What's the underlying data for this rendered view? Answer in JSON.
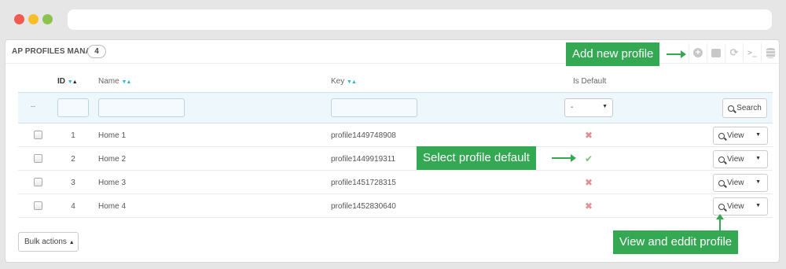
{
  "panel": {
    "title": "AP PROFILES MANAGE",
    "count": "4"
  },
  "toolbar": {
    "icons": [
      "add-icon",
      "export-icon",
      "refresh-icon",
      "sql-icon",
      "database-icon"
    ],
    "sql_glyph": ">_"
  },
  "table": {
    "columns": {
      "id": "ID",
      "name": "Name",
      "key": "Key",
      "is_default": "Is Default"
    },
    "filters": {
      "dash": "--",
      "default_select_value": "-",
      "search_label": "Search"
    },
    "rows": [
      {
        "id": "1",
        "name": "Home 1",
        "key": "profile1449748908",
        "is_default": false,
        "action": "View"
      },
      {
        "id": "2",
        "name": "Home 2",
        "key": "profile1449919311",
        "is_default": true,
        "action": "View"
      },
      {
        "id": "3",
        "name": "Home 3",
        "key": "profile1451728315",
        "is_default": false,
        "action": "View"
      },
      {
        "id": "4",
        "name": "Home 4",
        "key": "profile1452830640",
        "is_default": false,
        "action": "View"
      }
    ],
    "bulk_actions_label": "Bulk actions"
  },
  "callouts": {
    "add_new": "Add new profile",
    "select_default": "Select profile default",
    "view_edit": "View and eddit profile"
  },
  "colors": {
    "callout": "#34a853",
    "sort_arrow": "#25b9d7",
    "status_no": "#e08f95",
    "status_yes": "#72c279"
  }
}
